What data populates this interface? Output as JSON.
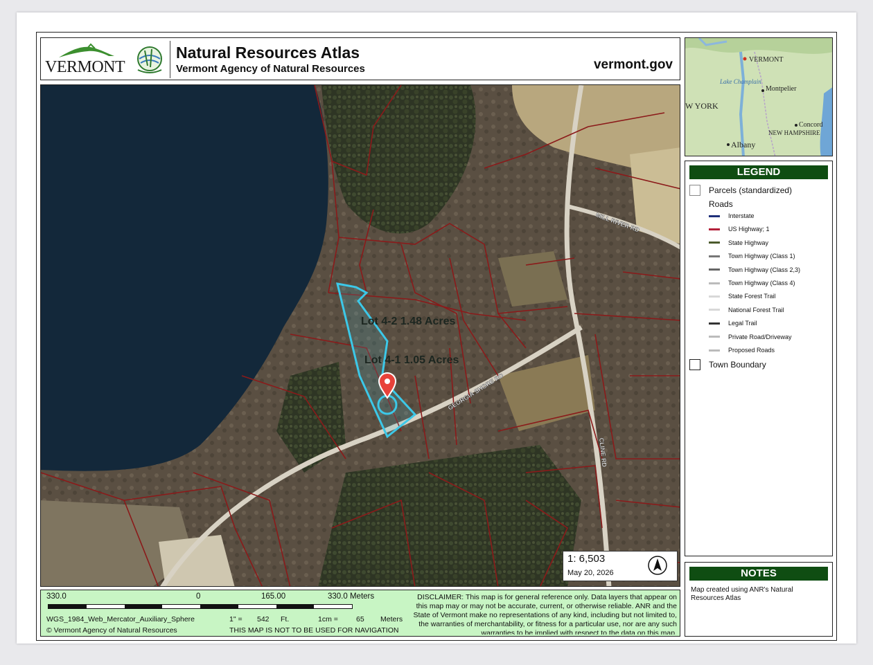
{
  "header": {
    "logo_text": "VERMONT",
    "title": "Natural Resources Atlas",
    "subtitle": "Vermont Agency of Natural Resources",
    "site": "vermont.gov"
  },
  "map": {
    "lot_a": "Lot 4-2  1.48 Acres",
    "lot_b": "Lot 4-1  1.05 Acres",
    "road_georgia": "GEORGIA SHORE RD",
    "road_mill": "MILL RIVER RD",
    "road_cline": "CLINE RD",
    "scale_ratio": "1:  6,503",
    "date": "May 20, 2026"
  },
  "locator": {
    "labels": [
      "VERMONT",
      "Lake Champlain",
      "Montpelier",
      "W YORK",
      "NEW HAMPSHIRE",
      "Concord",
      "Albany"
    ]
  },
  "legend": {
    "title": "LEGEND",
    "parcels": "Parcels (standardized)",
    "roads": "Roads",
    "road_types": [
      {
        "label": "Interstate",
        "color": "#1e2f7a"
      },
      {
        "label": "US Highway; 1",
        "color": "#b3203a"
      },
      {
        "label": "State Highway",
        "color": "#4b5a2c"
      },
      {
        "label": "Town Highway (Class 1)",
        "color": "#777777"
      },
      {
        "label": "Town Highway (Class 2,3)",
        "color": "#666666"
      },
      {
        "label": "Town Highway (Class 4)",
        "color": "#bbbbbb"
      },
      {
        "label": "State Forest Trail",
        "color": "#d8d8d8"
      },
      {
        "label": "National Forest Trail",
        "color": "#d8d8d8"
      },
      {
        "label": "Legal Trail",
        "color": "#333333"
      },
      {
        "label": "Private Road/Driveway",
        "color": "#bbbbbb"
      },
      {
        "label": "Proposed Roads",
        "color": "#bbbbbb"
      }
    ],
    "town_boundary": "Town Boundary"
  },
  "notes": {
    "title": "NOTES",
    "text": "Map created using ANR's Natural Resources Atlas"
  },
  "footer": {
    "scale_left": "330.0",
    "scale_zero": "0",
    "scale_mid": "165.00",
    "scale_right": "330.0 Meters",
    "projection": "WGS_1984_Web_Mercator_Auxiliary_Sphere",
    "inch_label": "1\" =",
    "inch_value": "542",
    "inch_unit": "Ft.",
    "cm_label": "1cm =",
    "cm_value": "65",
    "cm_unit": "Meters",
    "copyright": "© Vermont Agency of Natural Resources",
    "nav_warning": "THIS MAP IS NOT TO BE USED FOR NAVIGATION",
    "disclaimer": "DISCLAIMER: This map is for general reference only. Data layers that appear on this map may or may not be accurate, current, or otherwise reliable. ANR and the State of Vermont make no representations of any kind, including but not limited to, the warranties of merchantability, or fitness for a particular use, nor are any such warranties to be implied with respect to the data on this map."
  },
  "colors": {
    "parcel_line": "#8b1a1a",
    "selected_parcel": "#3cc8e8",
    "legend_header": "#0f4d12",
    "footer_bg": "#c8f5c4"
  }
}
